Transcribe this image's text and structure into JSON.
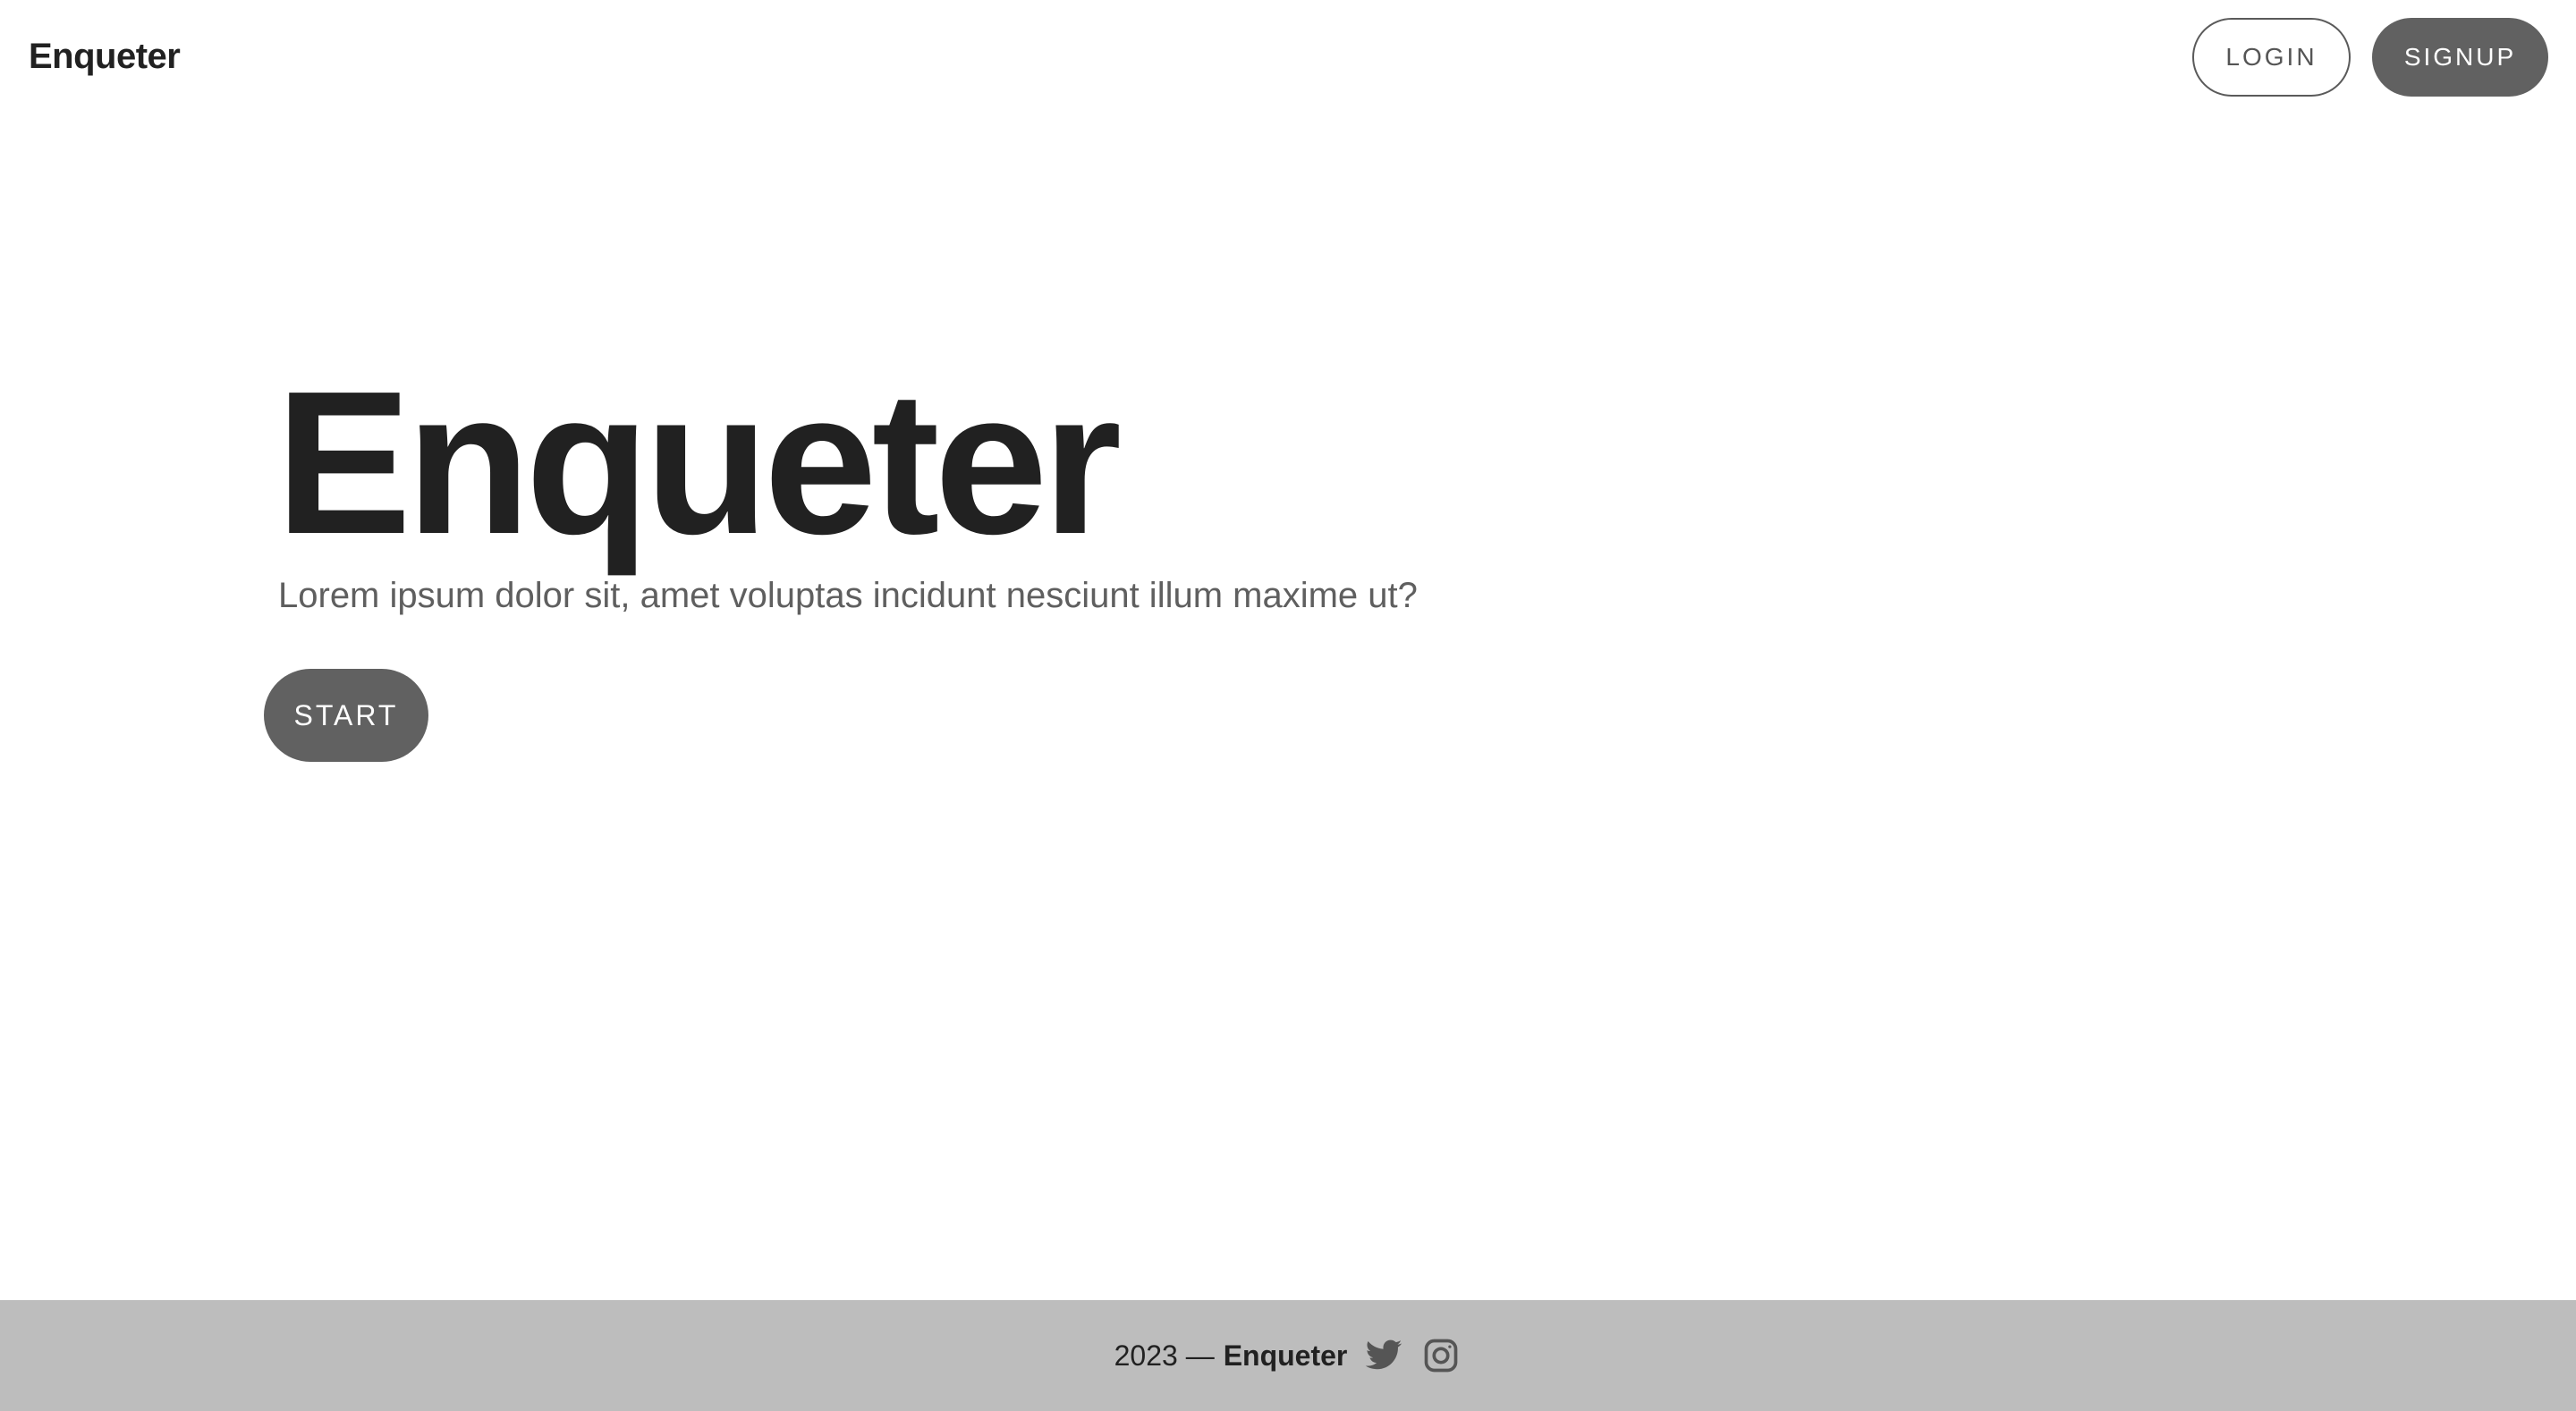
{
  "header": {
    "brand": "Enqueter",
    "login_label": "LOGIN",
    "signup_label": "SIGNUP"
  },
  "hero": {
    "title": "Enqueter",
    "subtitle": "Lorem ipsum dolor sit, amet voluptas incidunt nesciunt illum maxime ut?",
    "start_label": "START"
  },
  "footer": {
    "year_text": "2023 —",
    "brand": "Enqueter",
    "icons": [
      "twitter-icon",
      "instagram-icon"
    ]
  },
  "colors": {
    "primary_button": "#616161",
    "text": "#212121",
    "subtitle": "#5f5f5f",
    "footer_bg": "#bdbdbd"
  }
}
